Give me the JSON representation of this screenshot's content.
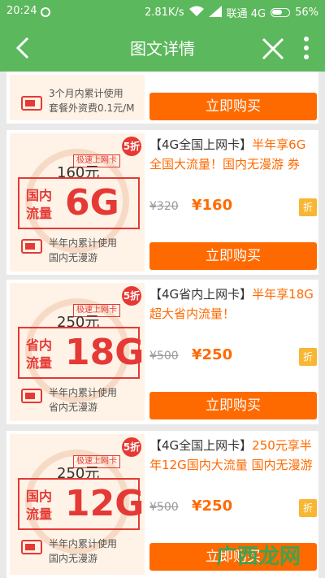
{
  "status": {
    "time": "20:24",
    "speed": "2.81K/s",
    "carrier": "联通 4G",
    "battery": "56%"
  },
  "nav": {
    "title": "图文详情"
  },
  "partial_card": {
    "note_line1": "3个月内累计使用",
    "note_line2": "套餐外资费0.1元/M",
    "buy_label": "立即购买"
  },
  "cards": [
    {
      "discount": "5折",
      "speed_tag": "极速上网卡",
      "price_yuan": "160元",
      "region_line1": "国内",
      "region_line2": "流量",
      "big": "6G",
      "note_line1": "半年内累计使用",
      "note_line2": "国内无漫游",
      "title_tag": "【4G全国上网卡】",
      "title_rest": "半年享6G全国大流量！国内无漫游 券",
      "orig_price": "¥320",
      "now_price": "¥160",
      "zhe": "折",
      "buy_label": "立即购买"
    },
    {
      "discount": "5折",
      "speed_tag": "极速上网卡",
      "price_yuan": "250元",
      "region_line1": "省内",
      "region_line2": "流量",
      "big": "18G",
      "note_line1": "半年内累计使用",
      "note_line2": "省内无漫游",
      "title_tag": "【4G省内上网卡】",
      "title_rest": "半年享18G超大省内流量！",
      "orig_price": "¥500",
      "now_price": "¥250",
      "zhe": "折",
      "buy_label": "立即购买"
    },
    {
      "discount": "5折",
      "speed_tag": "极速上网卡",
      "price_yuan": "250元",
      "region_line1": "国内",
      "region_line2": "流量",
      "big": "12G",
      "note_line1": "半年内累计使用",
      "note_line2": "国内无漫游",
      "title_tag": "【4G全国上网卡】",
      "title_rest": "250元享半年12G国内大流量 国内无漫游",
      "orig_price": "¥500",
      "now_price": "¥250",
      "zhe": "折",
      "buy_label": "立即购买"
    }
  ],
  "watermark": "广西龙网",
  "colors": {
    "green": "#5cb85c",
    "orange": "#ff6a00",
    "red": "#e53935"
  }
}
